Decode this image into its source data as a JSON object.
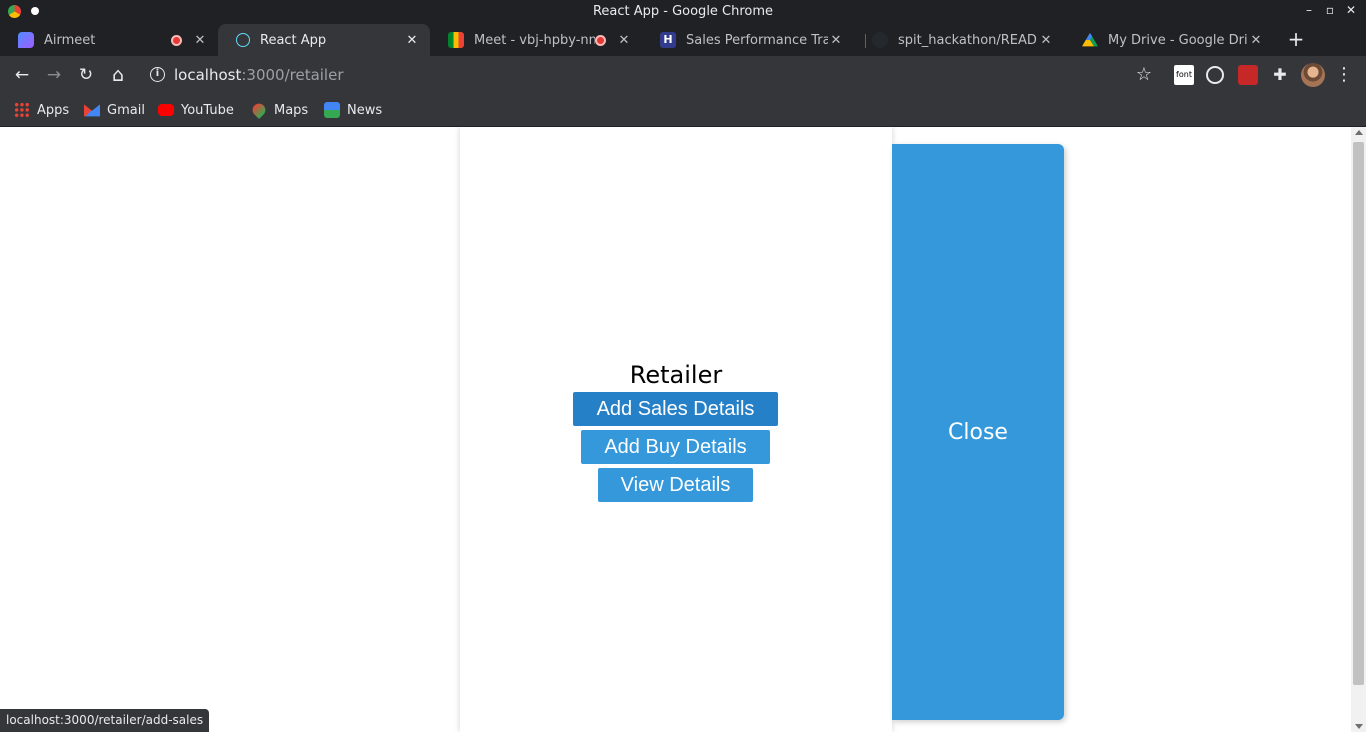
{
  "window": {
    "title": "React App - Google Chrome",
    "controls": {
      "minimize": "–",
      "maximize": "▫",
      "close": "✕"
    }
  },
  "tabs": [
    {
      "label": "Airmeet",
      "icon": "airmeet-icon",
      "color": "#7b61ff",
      "recording": true,
      "active": false
    },
    {
      "label": "React App",
      "icon": "react-icon",
      "color": "#61dafb",
      "recording": false,
      "active": true
    },
    {
      "label": "Meet - vbj-hpby-nnh",
      "icon": "google-meet-icon",
      "color": "#00897b",
      "recording": true,
      "active": false
    },
    {
      "label": "Sales Performance Track",
      "icon": "hackerearth-icon",
      "color": "#323b8c",
      "recording": false,
      "active": false
    },
    {
      "label": "spit_hackathon/READMI",
      "icon": "github-icon",
      "color": "#24292e",
      "recording": false,
      "active": false
    },
    {
      "label": "My Drive - Google Drive",
      "icon": "google-drive-icon",
      "color": "#fbbc05",
      "recording": false,
      "active": false
    }
  ],
  "new_tab": "+",
  "toolbar": {
    "back": "←",
    "forward": "→",
    "reload": "↻",
    "home": "⌂",
    "url_host": "localhost",
    "url_path": ":3000/retailer",
    "bookmark_star": "☆",
    "menu": "⋮"
  },
  "bookmarks": [
    {
      "label": "Apps",
      "icon": "apps-grid-icon"
    },
    {
      "label": "Gmail",
      "icon": "gmail-icon"
    },
    {
      "label": "YouTube",
      "icon": "youtube-icon"
    },
    {
      "label": "Maps",
      "icon": "google-maps-icon"
    },
    {
      "label": "News",
      "icon": "google-news-icon"
    }
  ],
  "page": {
    "title": "Retailer",
    "buttons": {
      "add_sales": "Add Sales Details",
      "add_buy": "Add Buy Details",
      "view": "View Details"
    },
    "drawer_close": "Close"
  },
  "status_url": "localhost:3000/retailer/add-sales",
  "colors": {
    "primary": "#3498db",
    "primary_hover": "#2680c7",
    "chrome_dark": "#202124",
    "chrome_toolbar": "#35363a"
  }
}
